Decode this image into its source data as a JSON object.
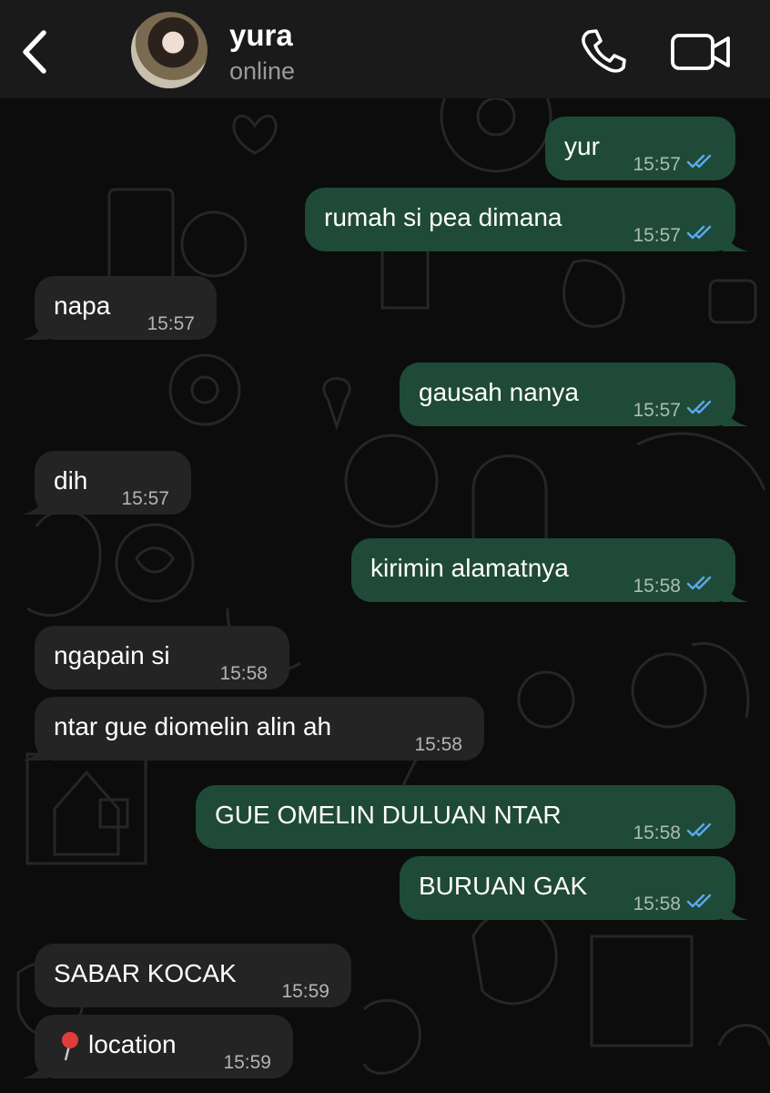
{
  "header": {
    "name": "yura",
    "status": "online"
  },
  "colors": {
    "outgoing_bubble": "#1f4a37",
    "incoming_bubble": "#242424",
    "read_ticks": "#5aa9ef",
    "header_bg": "#1a1a1a"
  },
  "icons": [
    "chevron-left-icon",
    "phone-icon",
    "video-camera-icon",
    "double-check-icon",
    "pushpin-icon"
  ],
  "messages": [
    {
      "dir": "out",
      "text": "yur",
      "time": "15:57",
      "read": true
    },
    {
      "dir": "out",
      "text": "rumah si pea dimana",
      "time": "15:57",
      "read": true
    },
    {
      "dir": "in",
      "text": "napa",
      "time": "15:57"
    },
    {
      "dir": "out",
      "text": "gausah nanya",
      "time": "15:57",
      "read": true
    },
    {
      "dir": "in",
      "text": "dih",
      "time": "15:57"
    },
    {
      "dir": "out",
      "text": "kirimin alamatnya",
      "time": "15:58",
      "read": true
    },
    {
      "dir": "in",
      "text": "ngapain si",
      "time": "15:58"
    },
    {
      "dir": "in",
      "text": "ntar gue diomelin alin ah",
      "time": "15:58"
    },
    {
      "dir": "out",
      "text": "GUE OMELIN DULUAN NTAR",
      "time": "15:58",
      "read": true
    },
    {
      "dir": "out",
      "text": "BURUAN GAK",
      "time": "15:58",
      "read": true
    },
    {
      "dir": "in",
      "text": "SABAR KOCAK",
      "time": "15:59"
    },
    {
      "dir": "in",
      "text": "location",
      "time": "15:59"
    }
  ]
}
